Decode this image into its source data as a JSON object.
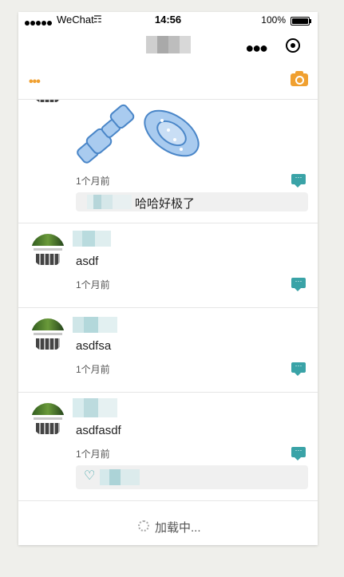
{
  "status_bar": {
    "carrier": "WeChat",
    "time": "14:56",
    "battery": "100%"
  },
  "nav": {
    "title_blurred": true
  },
  "colors": {
    "accent_orange": "#f0a030",
    "accent_teal": "#3aa3a7"
  },
  "posts": [
    {
      "time": "1个月前",
      "has_image": true,
      "comment_text": "哈哈好极了"
    },
    {
      "time": "1个月前",
      "content": "asdf"
    },
    {
      "time": "1个月前",
      "content": "asdfsa"
    },
    {
      "time": "1个月前",
      "content": "asdfasdf"
    }
  ],
  "loading": {
    "text": "加载中..."
  }
}
